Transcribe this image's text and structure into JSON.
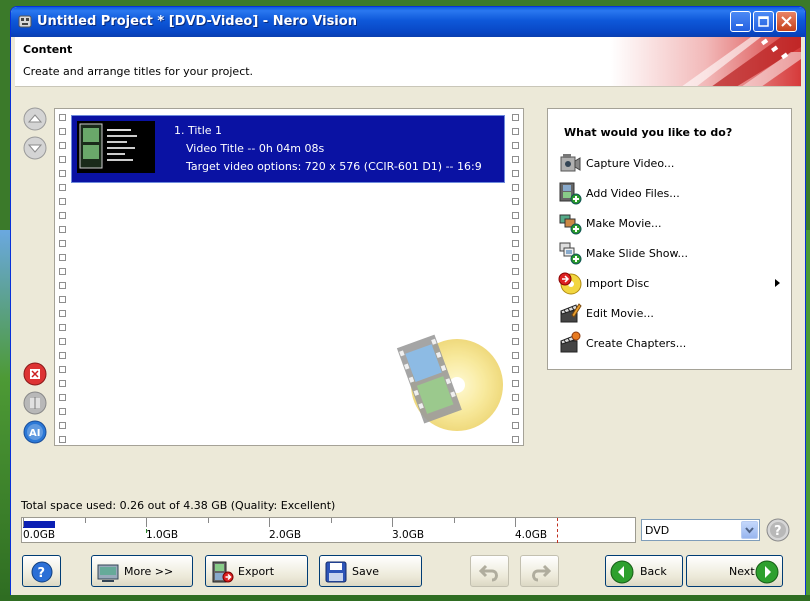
{
  "window": {
    "title": "Untitled Project * [DVD-Video] - Nero Vision"
  },
  "header": {
    "title": "Content",
    "subtitle": "Create and arrange titles for your project."
  },
  "titles": [
    {
      "line1": "1. Title 1",
      "line2": "Video Title -- 0h 04m 08s",
      "line3": "Target video options: 720 x 576 (CCIR-601 D1) -- 16:9"
    }
  ],
  "tasks": {
    "heading": "What would you like to do?",
    "items": [
      {
        "label": "Capture Video...",
        "icon": "camcorder-icon"
      },
      {
        "label": "Add Video Files...",
        "icon": "film-add-icon"
      },
      {
        "label": "Make Movie...",
        "icon": "make-movie-icon"
      },
      {
        "label": "Make Slide Show...",
        "icon": "slideshow-icon"
      },
      {
        "label": "Import Disc",
        "icon": "disc-import-icon",
        "submenu": true
      },
      {
        "label": "Edit Movie...",
        "icon": "clapper-edit-icon"
      },
      {
        "label": "Create Chapters...",
        "icon": "clapper-chapters-icon"
      }
    ]
  },
  "space": {
    "label": "Total space used: 0.26 out of 4.38 GB (Quality: Excellent)",
    "used_gb": 0.26,
    "capacity_gb": 4.38,
    "ticks": [
      "0.0GB",
      "1.0GB",
      "2.0GB",
      "3.0GB",
      "4.0GB"
    ]
  },
  "disc_type": {
    "value": "DVD"
  },
  "buttons": {
    "more": "More >>",
    "export": "Export",
    "save": "Save",
    "back": "Back",
    "next": "Next"
  },
  "colors": {
    "selection": "#0a12a3",
    "titlebar": "#0a5bdf",
    "capacity_fill": "#0b1fb3"
  }
}
